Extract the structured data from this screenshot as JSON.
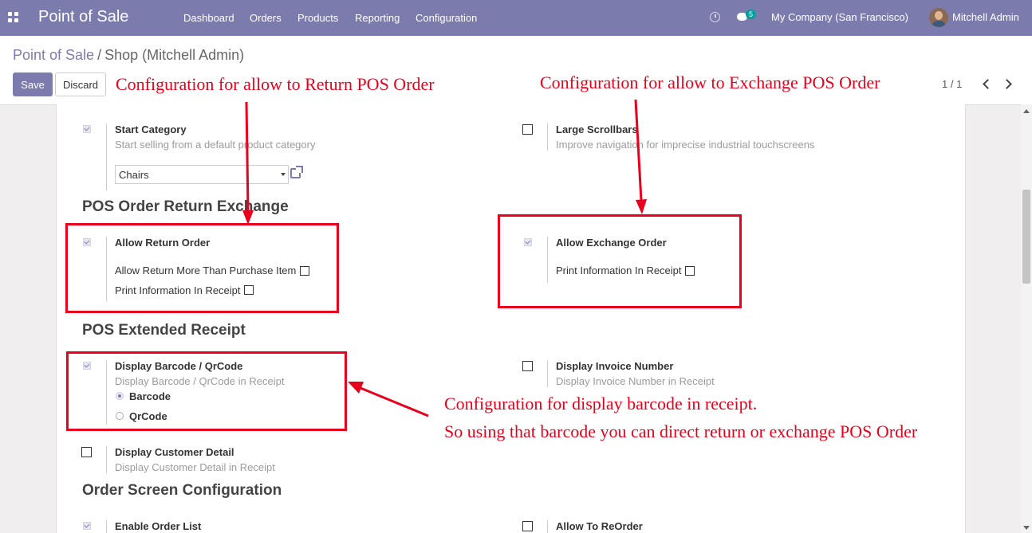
{
  "navbar": {
    "brand": "Point of Sale",
    "menu": [
      "Dashboard",
      "Orders",
      "Products",
      "Reporting",
      "Configuration"
    ],
    "message_count": "5",
    "company": "My Company (San Francisco)",
    "user": "Mitchell Admin"
  },
  "breadcrumb": {
    "parent": "Point of Sale",
    "separator": "/",
    "current": "Shop (Mitchell Admin)"
  },
  "buttons": {
    "save": "Save",
    "discard": "Discard"
  },
  "pager": "1 / 1",
  "settings": {
    "start_category": {
      "label": "Start Category",
      "help": "Start selling from a default product category",
      "value": "Chairs",
      "checked": true
    },
    "large_scrollbars": {
      "label": "Large Scrollbars",
      "help": "Improve navigation for imprecise industrial touchscreens",
      "checked": false
    },
    "return_exchange": {
      "title": "POS Order Return Exchange",
      "allow_return": {
        "label": "Allow Return Order",
        "checked": true,
        "more_than_purchase": "Allow Return More Than Purchase Item",
        "print_info": "Print Information In Receipt"
      },
      "allow_exchange": {
        "label": "Allow Exchange Order",
        "checked": true,
        "print_info": "Print Information In Receipt"
      }
    },
    "extended_receipt": {
      "title": "POS Extended Receipt",
      "barcode": {
        "label": "Display Barcode / QrCode",
        "help": "Display Barcode / QrCode in Receipt",
        "checked": true,
        "options": [
          "Barcode",
          "QrCode"
        ],
        "selected": "Barcode"
      },
      "invoice_number": {
        "label": "Display Invoice Number",
        "help": "Display Invoice Number in Receipt",
        "checked": false
      },
      "customer_detail": {
        "label": "Display Customer Detail",
        "help": "Display Customer Detail in Receipt",
        "checked": false
      }
    },
    "order_screen": {
      "title": "Order Screen Configuration",
      "enable_order_list": {
        "label": "Enable Order List",
        "checked": true
      },
      "allow_reorder": {
        "label": "Allow To ReOrder",
        "checked": false
      }
    }
  },
  "annotations": {
    "return_note": "Configuration for allow to Return POS Order",
    "exchange_note": "Configuration for allow to Exchange POS Order",
    "barcode_note_1": "Configuration for display barcode in receipt.",
    "barcode_note_2": "So using that barcode you can direct return or exchange POS Order",
    "color": "#e8001c"
  },
  "colors": {
    "navbar": "#7c7bad",
    "primary": "#7c7bad"
  }
}
